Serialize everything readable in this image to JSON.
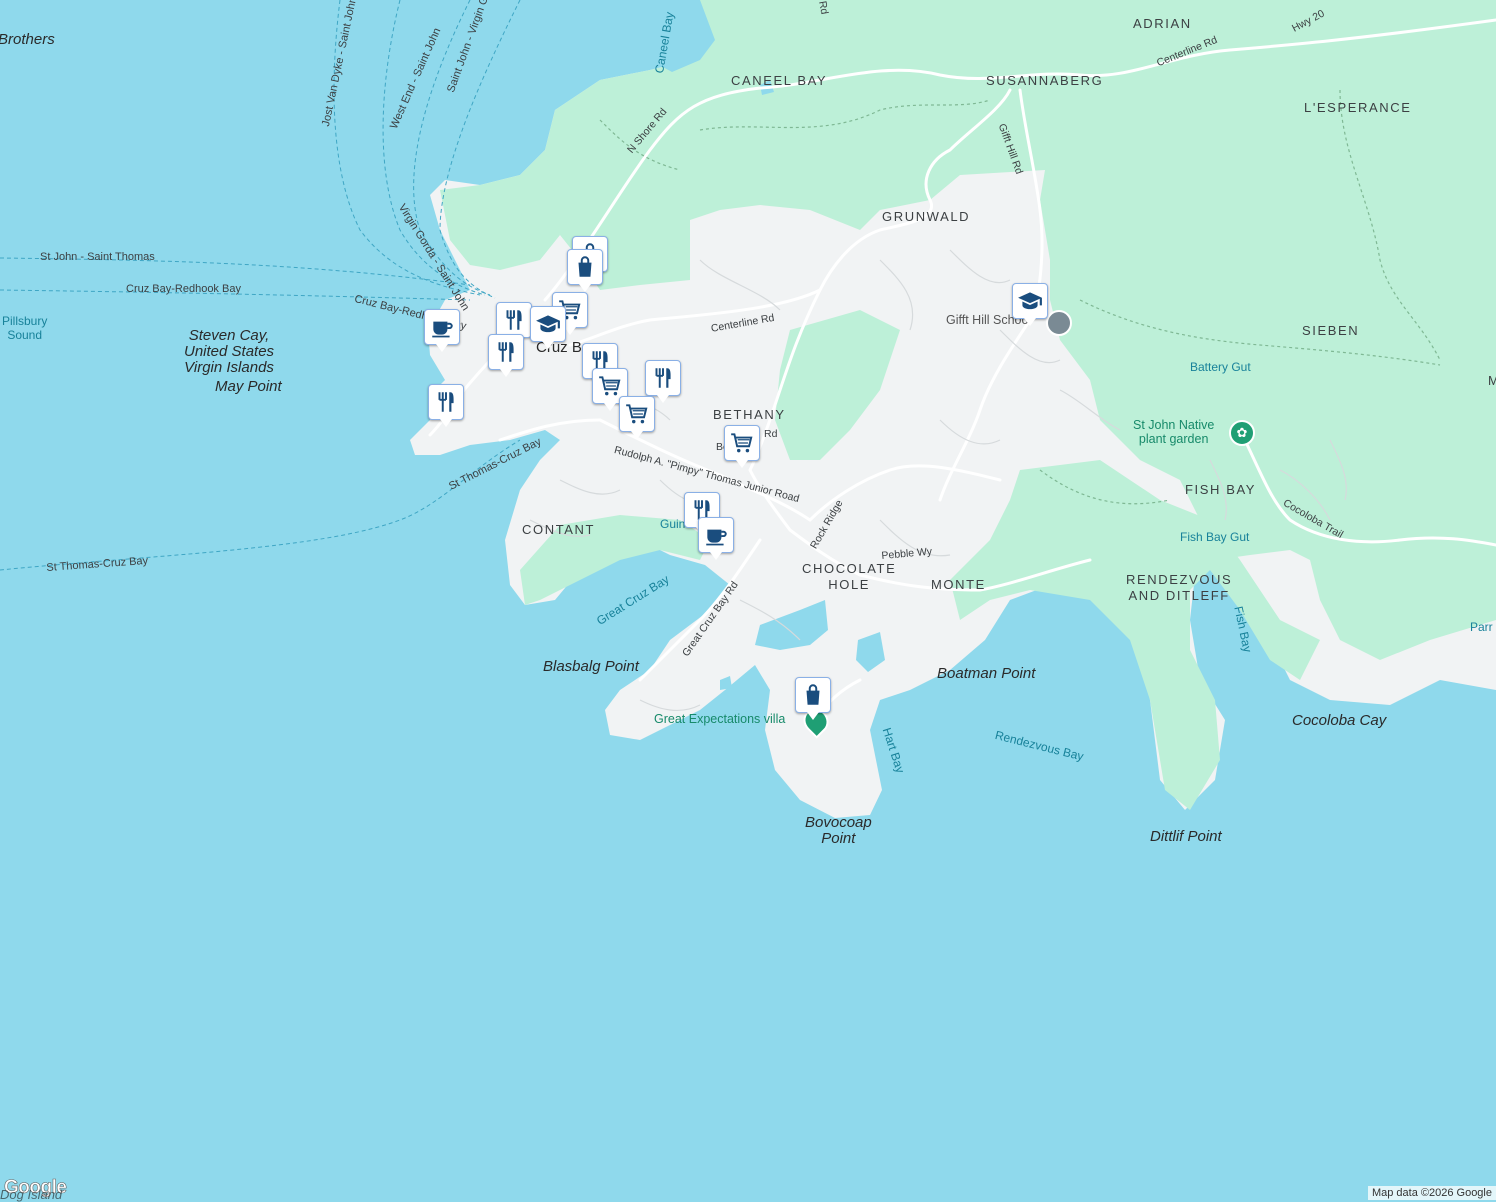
{
  "colors": {
    "water": "#8fd9ec",
    "land": "#f1f3f4",
    "park": "#bdf0d8",
    "road": "#ffffff",
    "pin_icon": "#1a4d7e",
    "pin_border": "#8ab0e6",
    "water_text": "#18829a"
  },
  "labels": {
    "brothers": "Brothers",
    "caneel_bay_water": "Caneel Bay",
    "caneel_bay": "CANEEL BAY",
    "adrian": "ADRIAN",
    "susannaberg": "SUSANNABERG",
    "lesperance": "L'ESPERANCE",
    "grunwald": "GRUNWALD",
    "sieben": "SIEBEN",
    "bethany": "BETHANY",
    "contant": "CONTANT",
    "chocolate_hole": "CHOCOLATE\nHOLE",
    "monte": "MONTE",
    "fish_bay": "FISH BAY",
    "rendezvous": "RENDEZVOUS\nAND DITLEFF",
    "steven_cay": "Steven Cay,\nUnited States\nVirgin Islands",
    "may_point": "May Point",
    "blasbalg": "Blasbalg Point",
    "boatman": "Boatman Point",
    "bovocoap": "Bovocoap\nPoint",
    "dittlif": "Dittlif Point",
    "cocoloba_cay": "Cocoloba Cay",
    "pillsbury": "Pillsbury\nSound",
    "great_cruz_bay": "Great Cruz Bay",
    "hart_bay": "Hart Bay",
    "rendezvous_bay": "Rendezvous Bay",
    "fish_bay_water": "Fish Bay",
    "fish_bay_gut": "Fish Bay Gut",
    "battery_gut": "Battery Gut",
    "cruz_bay": "Cruz B",
    "guin": "Guin",
    "parr": "Parr",
    "m_edge": "M",
    "n_shore_rd": "N Shore Rd",
    "centerline_rd_1": "Centerline Rd",
    "centerline_rd_2": "Centerline Rd",
    "gifft_hill_rd": "Gifft Hill Rd",
    "hwy": "Hwy 20",
    "rd_top": "Rd",
    "rudolph": "Rudolph A. \"Pimpy\" Thomas Junior Road",
    "rock_ridge": "Rock Ridge",
    "pebble_wy": "Pebble Wy",
    "great_cruz_bay_rd": "Great Cruz Bay Rd",
    "bethany_rd": "Be",
    "bethany_rd2": "Rd",
    "cocoloba_trail": "Cocoloba Trail",
    "st_thomas_cruz_bay_1": "St Thomas-Cruz Bay",
    "st_thomas_cruz_bay_2": "St Thomas-Cruz Bay",
    "st_john_saint_thomas": "St John - Saint Thomas",
    "cruz_bay_redhook": "Cruz Bay-Redhook Bay",
    "cruz_bay_redhook_2": "Cruz Bay-Redhook Bay",
    "jost_van_dyke": "Jost Van Dyke - Saint John",
    "west_end": "West End - Saint John",
    "saint_john_virgin": "Saint John - Virgin Gorda",
    "virgin_gorda": "Virgin Gorda - Saint John",
    "gifft_hill_school": "Gifft Hill School",
    "native_plant": "St John Native\nplant garden",
    "great_expectations": "Great Expectations villa"
  },
  "pins": [
    {
      "name": "shopping-pin-cruz-bay-1",
      "icon": "shopping-bag-icon"
    },
    {
      "name": "shopping-pin-cruz-bay-2",
      "icon": "shopping-bag-icon"
    },
    {
      "name": "cafe-pin-west",
      "icon": "coffee-cup-icon"
    },
    {
      "name": "restaurant-pin-cruz-bay-1",
      "icon": "restaurant-icon"
    },
    {
      "name": "grocery-pin-cruz-bay-1",
      "icon": "shopping-cart-icon"
    },
    {
      "name": "school-pin-cruz-bay",
      "icon": "school-icon"
    },
    {
      "name": "restaurant-pin-cruz-bay-2",
      "icon": "restaurant-icon"
    },
    {
      "name": "restaurant-pin-point",
      "icon": "restaurant-icon"
    },
    {
      "name": "restaurant-pin-mid",
      "icon": "restaurant-icon"
    },
    {
      "name": "grocery-pin-mid-1",
      "icon": "shopping-cart-icon"
    },
    {
      "name": "restaurant-pin-mid-2",
      "icon": "restaurant-icon"
    },
    {
      "name": "grocery-pin-mid-2",
      "icon": "shopping-cart-icon"
    },
    {
      "name": "grocery-pin-bethany",
      "icon": "shopping-cart-icon"
    },
    {
      "name": "restaurant-pin-guinea",
      "icon": "restaurant-icon"
    },
    {
      "name": "cafe-pin-guinea",
      "icon": "coffee-cup-icon"
    },
    {
      "name": "school-pin-gifft-hill",
      "icon": "school-icon"
    },
    {
      "name": "shopping-pin-great-expectations",
      "icon": "shopping-bag-icon"
    }
  ],
  "footer": {
    "attribution": "Map data ©2026 Google",
    "logo": "Google",
    "logo_under": "Dog Island"
  }
}
